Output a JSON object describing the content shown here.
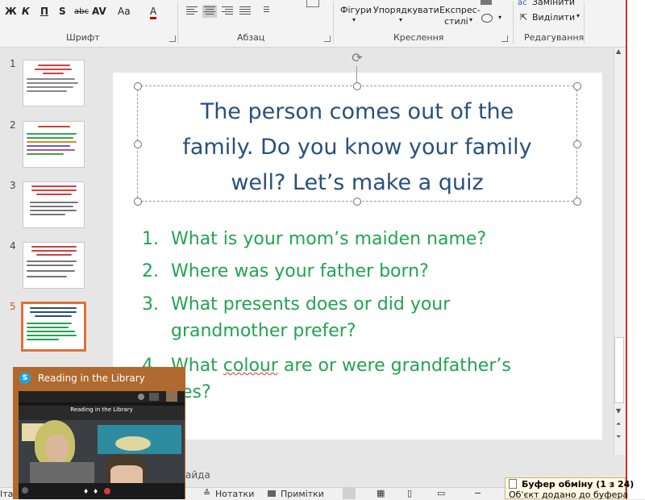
{
  "ribbon": {
    "font_buttons": [
      "Ж",
      "К",
      "П",
      "S",
      "abc",
      "AV",
      "Aa",
      "A"
    ],
    "groups": {
      "font": "Шрифт",
      "paragraph": "Абзац",
      "drawing": "Креслення",
      "editing": "Редагування"
    },
    "drawing_buttons": {
      "shapes": "Фігури",
      "arrange": "Упорядкувати",
      "quick_styles_line1": "Експрес-",
      "quick_styles_line2": "стилі"
    },
    "editing_buttons": {
      "replace": "Замінити",
      "select": "Виділити"
    }
  },
  "thumbnails": [
    {
      "number": "1"
    },
    {
      "number": "2"
    },
    {
      "number": "3"
    },
    {
      "number": "4"
    },
    {
      "number": "5",
      "selected": true
    }
  ],
  "slide": {
    "title_lines": [
      "The person comes out of the",
      "family. Do you know your family",
      "well? Let’s make a quiz"
    ],
    "items": [
      {
        "num": "1.",
        "lines": [
          "What is your mom’s maiden name?"
        ]
      },
      {
        "num": "2.",
        "lines": [
          "Where was your father born?"
        ]
      },
      {
        "num": "3.",
        "lines": [
          "What presents does or did your",
          "grandmother prefer?"
        ]
      },
      {
        "num": "4.",
        "prefix": "What ",
        "underlined": "colour",
        "rest": " are or were grandfather’s",
        "line2": "yes?"
      }
    ]
  },
  "notes_bar": {
    "partial_text": "айда"
  },
  "status_bar": {
    "left_partial": "Іта",
    "notes": "Нотатки",
    "comments": "Примітки"
  },
  "skype": {
    "title": "Reading in the Library",
    "logo": "S",
    "inner_title": "Reading in the Library"
  },
  "clipboard": {
    "line1": "Буфер обміну (1 з 24)",
    "line2": "Об'єкт додано до буфера"
  },
  "colors": {
    "title": "#28507d",
    "list": "#23a34f",
    "selected_thumb": "#e0703a",
    "skype_frame": "#b06a2f"
  }
}
